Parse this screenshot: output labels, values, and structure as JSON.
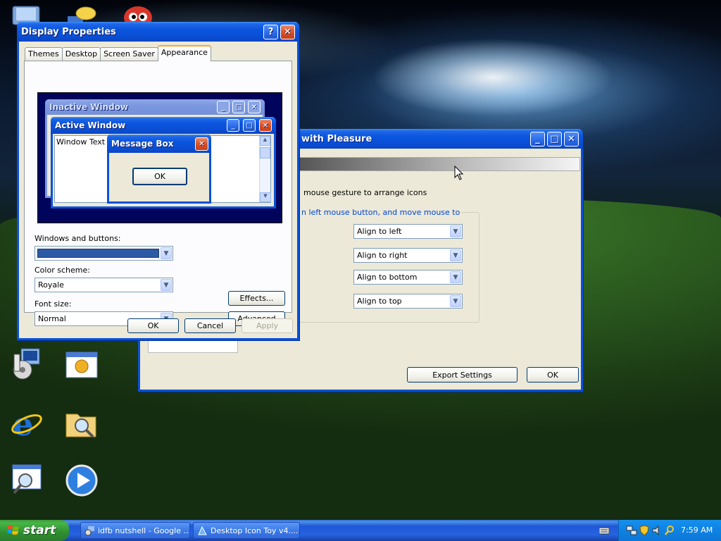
{
  "display_properties": {
    "title": "Display Properties",
    "tabs": [
      "Themes",
      "Desktop",
      "Screen Saver",
      "Appearance"
    ],
    "active_tab": "Appearance",
    "preview": {
      "inactive_window_title": "Inactive Window",
      "active_window_title": "Active Window",
      "window_text": "Window Text",
      "message_box_title": "Message Box",
      "message_box_ok": "OK"
    },
    "windows_buttons_label": "Windows and buttons:",
    "color_scheme_label": "Color scheme:",
    "color_scheme_value": "Royale",
    "font_size_label": "Font size:",
    "font_size_value": "Normal",
    "effects_button": "Effects...",
    "advanced_button": "Advanced",
    "ok_button": "OK",
    "cancel_button": "Cancel",
    "apply_button": "Apply"
  },
  "icon_toy": {
    "title_visible": "with Pleasure",
    "gesture_text": "mouse gesture to arrange icons",
    "group_text": "n left mouse button, and move mouse to",
    "options": [
      "Align to left",
      "Align to right",
      "Align to bottom",
      "Align to top"
    ],
    "export_button": "Export Settings",
    "ok_button": "OK"
  },
  "taskbar": {
    "start_label": "start",
    "tasks": [
      "idfb nutshell - Google ...",
      "Desktop Icon Toy v4...."
    ],
    "clock": "7:59 AM"
  },
  "colors": {
    "xp_blue": "#0a52d8",
    "preview_bg": "#00045a",
    "window_bg": "#ece9d8",
    "royale_swatch": "#2e5ba6"
  }
}
